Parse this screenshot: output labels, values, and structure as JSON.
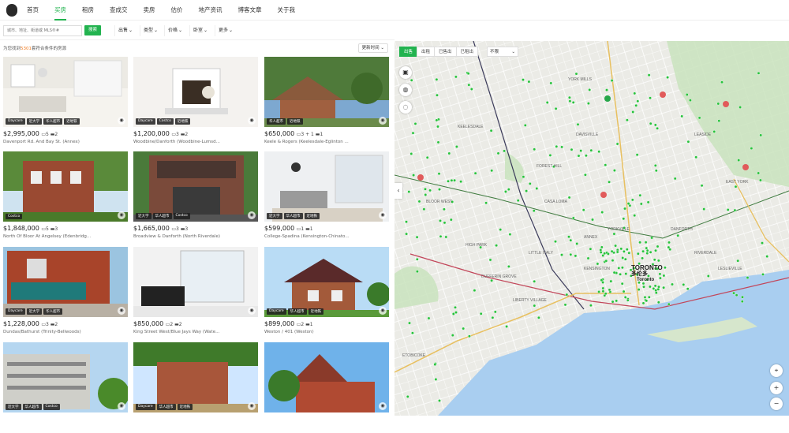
{
  "nav": {
    "items": [
      "首页",
      "买房",
      "租房",
      "查成交",
      "卖房",
      "估价",
      "地产资讯",
      "博客文章",
      "关于我"
    ],
    "active": 1
  },
  "search": {
    "placeholder": "城市、地址、街道或 MLS®#",
    "button": "搜索"
  },
  "filters": [
    "出售",
    "类型",
    "价格",
    "卧室",
    "更多"
  ],
  "results": {
    "prefix": "为您找到",
    "count": "5301",
    "suffix": "套符合条件的房源",
    "sort": "更新时间"
  },
  "listings": [
    {
      "price": "$2,995,000",
      "rooms": "▭5 ▬2",
      "address": "Davenport Rd. And Bay St. (Annex)",
      "tags": [
        "Daycare",
        "近大学",
        "华人超市",
        "近地铁"
      ]
    },
    {
      "price": "$1,200,000",
      "rooms": "▭3 ▬2",
      "address": "Woodbine/Danforth (Woodbine-Lumsd...",
      "tags": [
        "Daycare",
        "Costco",
        "近地铁"
      ]
    },
    {
      "price": "$650,000",
      "rooms": "▭3 + 1 ▬1",
      "address": "Keele & Rogers (Keelesdale-Eglinton ...",
      "tags": [
        "华人超市",
        "近地铁"
      ]
    },
    {
      "price": "$1,848,000",
      "rooms": "▭5 ▬3",
      "address": "North Of Bloor At Angelsey (Edenbridg...",
      "tags": [
        "Costco"
      ]
    },
    {
      "price": "$1,665,000",
      "rooms": "▭3 ▬3",
      "address": "Broadview & Danforth (North Riverdale)",
      "tags": [
        "近大学",
        "华人超市",
        "Costco"
      ]
    },
    {
      "price": "$599,000",
      "rooms": "▭1 ▬1",
      "address": "College-Spadina (Kensington-Chinato...",
      "tags": [
        "近大学",
        "华人超市",
        "近地铁"
      ]
    },
    {
      "price": "$1,228,000",
      "rooms": "▭3 ▬2",
      "address": "Dundas/Bathurst (Trinity-Bellwoods)",
      "tags": [
        "Daycare",
        "近大学",
        "华人超市"
      ]
    },
    {
      "price": "$850,000",
      "rooms": "▭2 ▬2",
      "address": "King Street West/Blue Jays Way (Wate...",
      "tags": []
    },
    {
      "price": "$899,000",
      "rooms": "▭2 ▬1",
      "address": "Weston / 401 (Weston)",
      "tags": [
        "Daycare",
        "华人超市",
        "近地铁"
      ]
    },
    {
      "price": "",
      "rooms": "",
      "address": "",
      "tags": [
        "近大学",
        "华人超市",
        "Costco"
      ]
    },
    {
      "price": "",
      "rooms": "",
      "address": "",
      "tags": [
        "Daycare",
        "华人超市",
        "近地铁"
      ]
    },
    {
      "price": "",
      "rooms": "",
      "address": "",
      "tags": []
    }
  ],
  "map": {
    "tabs": [
      "出售",
      "出租",
      "已售出",
      "已租出"
    ],
    "active_tab": 0,
    "time_filter": "不限",
    "labels": [
      "TORONTO",
      "多伦多",
      "Toronto",
      "YORKVILLE",
      "ANNEX",
      "LEASIDE",
      "YORK MILLS",
      "DAVISVILLE",
      "FOREST HILL",
      "CASA LOMA",
      "EAST YORK",
      "DANFORTH",
      "RIVERDALE",
      "LESLIEVILLE",
      "KENSINGTON",
      "LITTLE ITALY",
      "ETOBICOKE",
      "HIGH PARK",
      "DUFFERIN GROVE",
      "LIBERTY VILLAGE",
      "NORTH YORK",
      "KEELESDALE",
      "BLOOR WEST"
    ],
    "icons": {
      "layers": "layers-icon",
      "globe": "globe-icon",
      "draw": "draw-icon",
      "locate": "locate-icon",
      "zoom_in": "+",
      "zoom_out": "−",
      "collapse": "‹"
    }
  },
  "colors": {
    "accent": "#22b34f",
    "count": "#f07a1f",
    "water": "#a9cef0",
    "park": "#c9e3bd",
    "pin": "#27c23b"
  }
}
